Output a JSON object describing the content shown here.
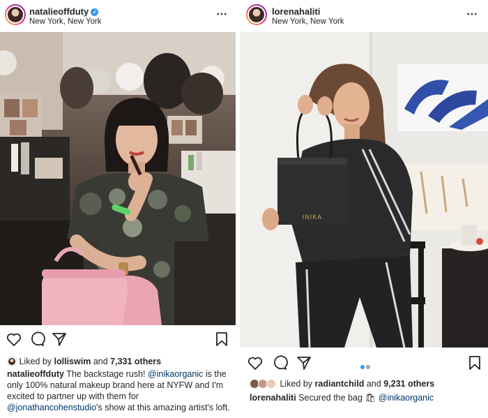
{
  "left_post": {
    "username": "natalieoffduty",
    "verified": true,
    "location": "New York, New York",
    "more_icon": "⋯",
    "liked_by_prefix": "Liked by",
    "liked_by_user": "lolliswim",
    "liked_by_and": "and",
    "likes_others": "7,331 others",
    "caption_user": "natalieoffduty",
    "caption_part1": "The backstage rush!",
    "caption_mention1": "@inikaorganic",
    "caption_part2": "is the only 100% natural makeup brand here at NYFW and I'm excited to partner up with them for",
    "caption_mention2": "@jonathancohenstudio",
    "caption_part3": "'s show at this amazing artist's loft."
  },
  "right_post": {
    "username": "lorenahaliti",
    "location": "New York, New York",
    "more_icon": "⋯",
    "bag_brand": "INIKA",
    "liked_by_prefix": "Liked by",
    "liked_by_user": "radiantchild",
    "liked_by_and": "and",
    "likes_others": "9,231 others",
    "caption_user": "lorenahaliti",
    "caption_text": "Secured the bag",
    "caption_emoji": "🛍",
    "caption_mention": "@inikaorganic",
    "carousel_dots": 2,
    "carousel_active": 1
  },
  "icons": {
    "like": "heart-icon",
    "comment": "comment-icon",
    "share": "share-icon",
    "save": "bookmark-icon"
  },
  "colors": {
    "text": "#262626",
    "mention": "#003569",
    "verified": "#3897f0",
    "dot_active": "#3897f0",
    "dot_inactive": "#a8a8a8"
  }
}
